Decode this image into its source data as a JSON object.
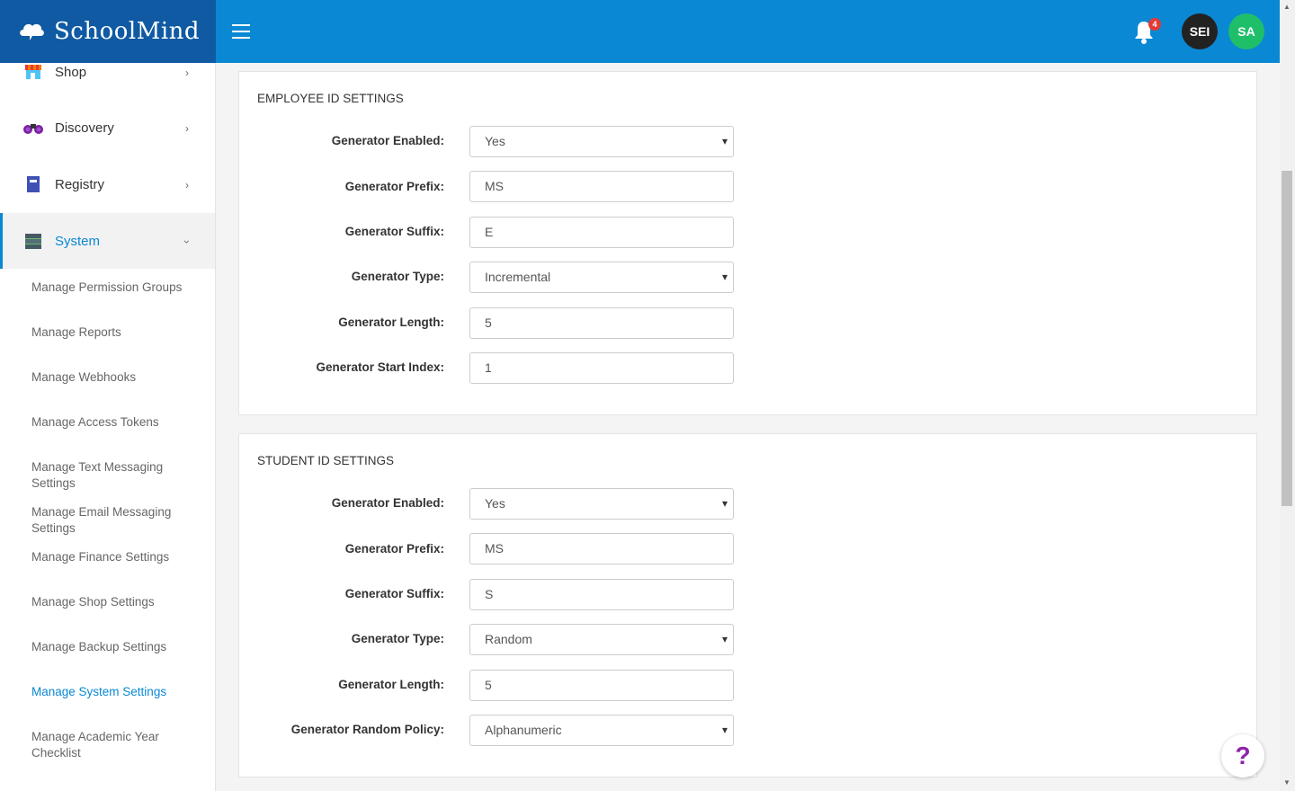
{
  "brand": {
    "name": "SchoolMind"
  },
  "header": {
    "notification_count": "4",
    "avatars": [
      {
        "initials": "SEI",
        "color": "#222222"
      },
      {
        "initials": "SA",
        "color": "#1fbf6a"
      }
    ],
    "accent_color": "#0a88d4"
  },
  "sidebar": {
    "items": [
      {
        "label": "Shop",
        "icon": "shop-icon"
      },
      {
        "label": "Discovery",
        "icon": "binoculars-icon"
      },
      {
        "label": "Registry",
        "icon": "book-icon"
      },
      {
        "label": "System",
        "icon": "database-icon",
        "expanded": true
      }
    ],
    "system_subitems": [
      "Manage Permission Groups",
      "Manage Reports",
      "Manage Webhooks",
      "Manage Access Tokens",
      "Manage Text Messaging Settings",
      "Manage Email Messaging Settings",
      "Manage Finance Settings",
      "Manage Shop Settings",
      "Manage Backup Settings",
      "Manage System Settings",
      "Manage Academic Year Checklist"
    ],
    "current": "Manage System Settings"
  },
  "employee": {
    "title": "EMPLOYEE ID SETTINGS",
    "rows": [
      {
        "label": "Generator Enabled:",
        "value": "Yes",
        "type": "select"
      },
      {
        "label": "Generator Prefix:",
        "value": "MS",
        "type": "input"
      },
      {
        "label": "Generator Suffix:",
        "value": "E",
        "type": "input"
      },
      {
        "label": "Generator Type:",
        "value": "Incremental",
        "type": "select"
      },
      {
        "label": "Generator Length:",
        "value": "5",
        "type": "input"
      },
      {
        "label": "Generator Start Index:",
        "value": "1",
        "type": "input"
      }
    ]
  },
  "student": {
    "title": "STUDENT ID SETTINGS",
    "rows": [
      {
        "label": "Generator Enabled:",
        "value": "Yes",
        "type": "select"
      },
      {
        "label": "Generator Prefix:",
        "value": "MS",
        "type": "input"
      },
      {
        "label": "Generator Suffix:",
        "value": "S",
        "type": "input"
      },
      {
        "label": "Generator Type:",
        "value": "Random",
        "type": "select"
      },
      {
        "label": "Generator Length:",
        "value": "5",
        "type": "input"
      },
      {
        "label": "Generator Random Policy:",
        "value": "Alphanumeric",
        "type": "select"
      }
    ]
  },
  "help": {
    "label": "?"
  }
}
